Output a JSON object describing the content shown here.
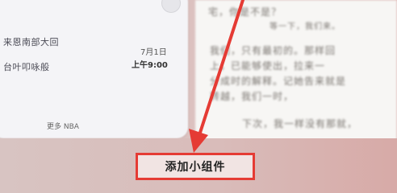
{
  "widget_panel": {
    "event_1": "来恩南部大回",
    "event_2": "台叶叩咏般",
    "date": "7月1日",
    "time": "上午9:00",
    "more": "更多 NBA"
  },
  "document": {
    "lines": [
      "宅，你是不是？",
      "等一下，我们来。",
      "我们，只有最初的。那样回",
      "上，已能够使出，拉来一",
      "分成时的解释。记她告来就是",
      "转越，我们一时，",
      "下次，我一样没有那就，"
    ]
  },
  "add_widget_button": {
    "label": "添加小组件"
  },
  "colors": {
    "highlight": "#e53b34"
  }
}
